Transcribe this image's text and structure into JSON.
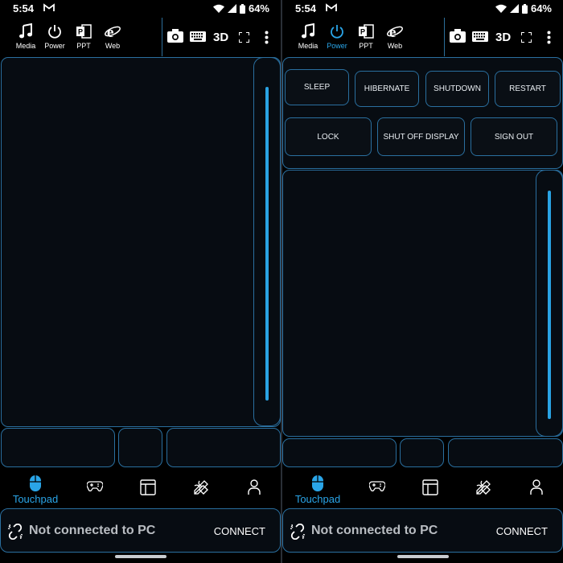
{
  "status_bar": {
    "time": "5:54",
    "battery": "64%"
  },
  "toolbar": {
    "items": [
      {
        "label": "Media",
        "icon": "music-note-icon"
      },
      {
        "label": "Power",
        "icon": "power-icon"
      },
      {
        "label": "PPT",
        "icon": "powerpoint-icon"
      },
      {
        "label": "Web",
        "icon": "browser-icon"
      }
    ],
    "right": {
      "camera": "camera-icon",
      "keyboard": "keyboard-icon",
      "three_d": "3D",
      "fullscreen": "fullscreen-icon",
      "menu": "more-vert-icon"
    }
  },
  "screens": [
    {
      "active_toolbar": "Media",
      "has_power_panel": false
    },
    {
      "active_toolbar": "Power",
      "has_power_panel": true
    }
  ],
  "power_panel": {
    "row1": [
      "SLEEP",
      "HIBERNATE",
      "SHUTDOWN",
      "RESTART"
    ],
    "row2": [
      "LOCK",
      "SHUT OFF DISPLAY",
      "SIGN OUT"
    ]
  },
  "bottom_nav": {
    "active_label": "Touchpad",
    "items": [
      "touchpad-icon",
      "gamepad-icon",
      "layout-icon",
      "tools-icon",
      "profile-icon"
    ]
  },
  "connection": {
    "status": "Not connected to PC",
    "action": "CONNECT"
  },
  "colors": {
    "accent": "#2aa5e8",
    "border": "#2a6f9f",
    "background": "#000000"
  }
}
